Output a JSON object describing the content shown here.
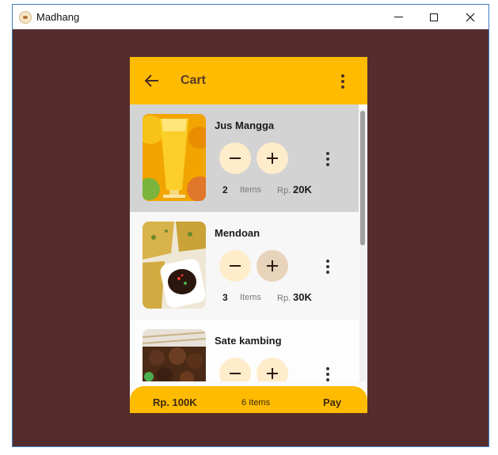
{
  "window": {
    "title": "Madhang"
  },
  "app": {
    "title": "Cart"
  },
  "cart": {
    "items": [
      {
        "name": "Jus Mangga",
        "qty": "2",
        "unit": "Items",
        "currency": "Rp.",
        "price": "20K"
      },
      {
        "name": "Mendoan",
        "qty": "3",
        "unit": "Items",
        "currency": "Rp.",
        "price": "30K"
      },
      {
        "name": "Sate kambing",
        "qty": "",
        "unit": "",
        "currency": "",
        "price": ""
      }
    ]
  },
  "footer": {
    "total": "Rp. 100K",
    "count": "6 Items",
    "pay": "Pay"
  },
  "colors": {
    "window_bg": "#552d2d",
    "accent": "#ffbb00",
    "selected_row": "#d3d3d3",
    "button_bg": "#ffeccb"
  },
  "icons": {
    "back": "arrow-left-icon",
    "menu": "more-vertical-icon",
    "minus": "minus-icon",
    "plus": "plus-icon"
  }
}
